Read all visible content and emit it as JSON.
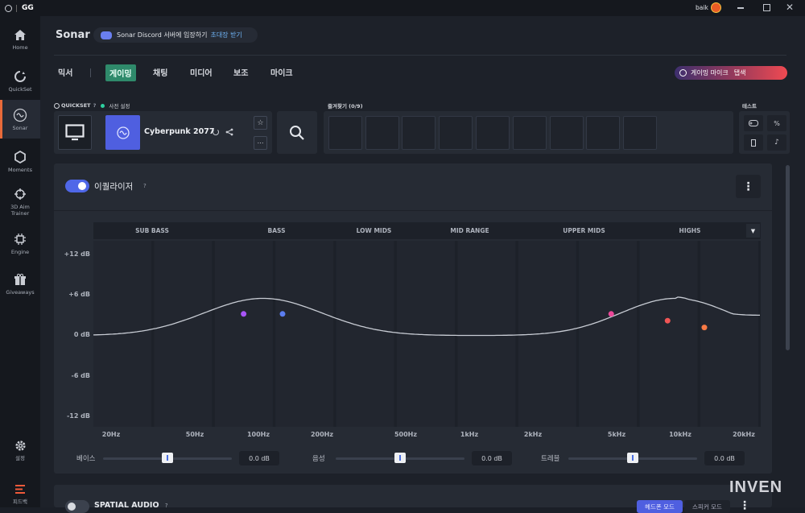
{
  "titlebar": {
    "logo": "GG",
    "user": "baik",
    "icons": [
      "steelseries-logo-icon",
      "avatar-icon",
      "minimize-icon",
      "maximize-icon",
      "close-icon"
    ]
  },
  "sidebar": {
    "items": [
      {
        "name": "home",
        "label": "Home",
        "icon": "home-icon"
      },
      {
        "name": "quickset",
        "label": "QuickSet",
        "icon": "quickset-icon"
      },
      {
        "name": "sonar",
        "label": "Sonar",
        "icon": "sonar-icon",
        "active": true
      },
      {
        "name": "moments",
        "label": "Moments",
        "icon": "moments-icon"
      },
      {
        "name": "aim-trainer",
        "label": "3D Aim Trainer",
        "icon": "aim-icon"
      },
      {
        "name": "engine",
        "label": "Engine",
        "icon": "engine-icon"
      },
      {
        "name": "giveaways",
        "label": "Giveaways",
        "icon": "gift-icon"
      },
      {
        "name": "settings",
        "label": "설정",
        "icon": "gear-icon"
      },
      {
        "name": "feedback",
        "label": "피드백",
        "icon": "feedback-icon"
      }
    ]
  },
  "header": {
    "title": "Sonar",
    "discord_text": "Sonar Discord 서버에 입장하기",
    "discord_link": "초대장 받기"
  },
  "tabs": [
    {
      "label": "믹서",
      "active": false
    },
    {
      "label": "게이밍",
      "active": true
    },
    {
      "label": "채팅",
      "active": false
    },
    {
      "label": "미디어",
      "active": false
    },
    {
      "label": "보조",
      "active": false
    },
    {
      "label": "마이크",
      "active": false
    }
  ],
  "mic_button": {
    "label": "게이밍 마이크",
    "action": "탭색"
  },
  "quickset": {
    "label": "QUICKSET",
    "help": "?",
    "preset_label": "사전 설정",
    "preset_name": "Cyberpunk 2077"
  },
  "favorites": {
    "label": "즐겨찾기 (0/9)",
    "slots": 9
  },
  "test": {
    "label": "테스트",
    "icons": [
      "controller-icon",
      "percent-icon",
      "device-icon",
      "music-icon"
    ]
  },
  "equalizer": {
    "title": "이퀄라이저",
    "help": "?",
    "enabled": true,
    "bands": [
      "SUB BASS",
      "BASS",
      "LOW MIDS",
      "MID RANGE",
      "UPPER MIDS",
      "HIGHS"
    ],
    "y_ticks": [
      "+12 dB",
      "+6 dB",
      "0 dB",
      "-6 dB",
      "-12 dB"
    ],
    "x_ticks": [
      "20Hz",
      "50Hz",
      "100Hz",
      "200Hz",
      "500Hz",
      "1kHz",
      "2kHz",
      "5kHz",
      "10kHz",
      "20kHz"
    ],
    "points": [
      {
        "freq": 85,
        "gain": 3,
        "color": "#a855f7"
      },
      {
        "freq": 130,
        "gain": 3,
        "color": "#5b7df0"
      },
      {
        "freq": 4700,
        "gain": 3,
        "color": "#ec4899"
      },
      {
        "freq": 8700,
        "gain": 2,
        "color": "#f05555"
      },
      {
        "freq": 13000,
        "gain": 1,
        "color": "#f87a45"
      }
    ],
    "colors": {
      "accent": "#4f67e8",
      "curve": "#c8ccd4",
      "grid": "#262b34"
    }
  },
  "sliders": [
    {
      "label": "베이스",
      "value": "0.0 dB"
    },
    {
      "label": "음성",
      "value": "0.0 dB"
    },
    {
      "label": "트레블",
      "value": "0.0 dB"
    }
  ],
  "spatial": {
    "title": "SPATIAL AUDIO",
    "help": "?",
    "enabled": false,
    "mode1": "헤드폰 모드",
    "mode2": "스피커 모드"
  },
  "watermark": "INVEN"
}
